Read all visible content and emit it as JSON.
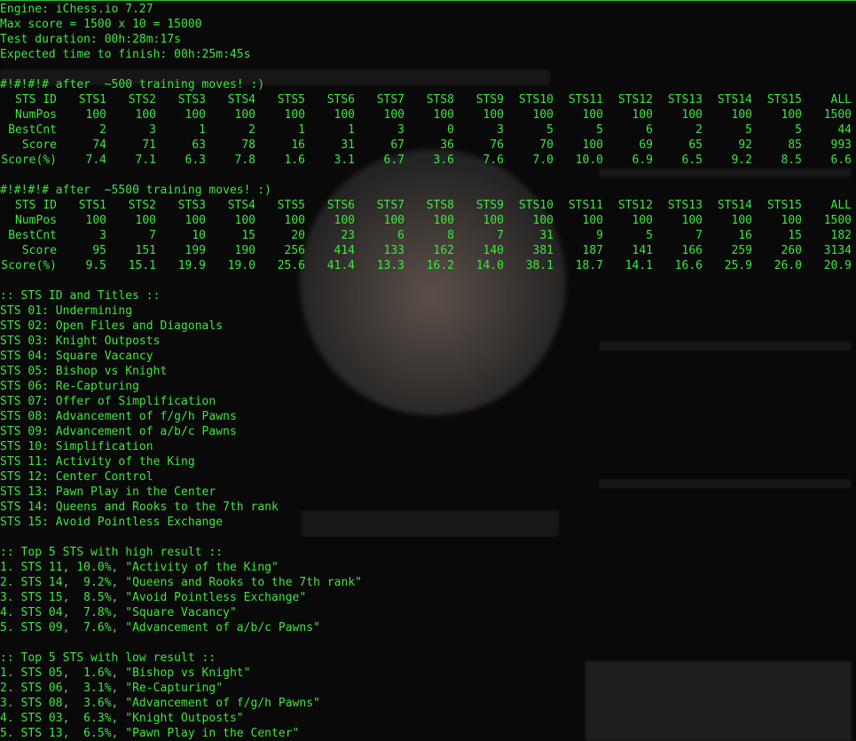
{
  "header": [
    "Engine: iChess.io 7.27",
    "Max score = 1500 x 10 = 15000",
    "Test duration: 00h:28m:17s",
    "Expected time to finish: 00h:25m:45s"
  ],
  "tables": [
    {
      "title": "#!#!#!# after  ~500 training moves! :)",
      "columns": [
        "STS ID",
        "STS1",
        "STS2",
        "STS3",
        "STS4",
        "STS5",
        "STS6",
        "STS7",
        "STS8",
        "STS9",
        "STS10",
        "STS11",
        "STS12",
        "STS13",
        "STS14",
        "STS15",
        "ALL"
      ],
      "rows": [
        [
          "NumPos",
          "100",
          "100",
          "100",
          "100",
          "100",
          "100",
          "100",
          "100",
          "100",
          "100",
          "100",
          "100",
          "100",
          "100",
          "100",
          "1500"
        ],
        [
          "BestCnt",
          "2",
          "3",
          "1",
          "2",
          "1",
          "1",
          "3",
          "0",
          "3",
          "5",
          "5",
          "6",
          "2",
          "5",
          "5",
          "44"
        ],
        [
          "Score",
          "74",
          "71",
          "63",
          "78",
          "16",
          "31",
          "67",
          "36",
          "76",
          "70",
          "100",
          "69",
          "65",
          "92",
          "85",
          "993"
        ],
        [
          "Score(%)",
          "7.4",
          "7.1",
          "6.3",
          "7.8",
          "1.6",
          "3.1",
          "6.7",
          "3.6",
          "7.6",
          "7.0",
          "10.0",
          "6.9",
          "6.5",
          "9.2",
          "8.5",
          "6.6"
        ]
      ]
    },
    {
      "title": "#!#!#!# after  ~5500 training moves! :)",
      "columns": [
        "STS ID",
        "STS1",
        "STS2",
        "STS3",
        "STS4",
        "STS5",
        "STS6",
        "STS7",
        "STS8",
        "STS9",
        "STS10",
        "STS11",
        "STS12",
        "STS13",
        "STS14",
        "STS15",
        "ALL"
      ],
      "rows": [
        [
          "NumPos",
          "100",
          "100",
          "100",
          "100",
          "100",
          "100",
          "100",
          "100",
          "100",
          "100",
          "100",
          "100",
          "100",
          "100",
          "100",
          "1500"
        ],
        [
          "BestCnt",
          "3",
          "7",
          "10",
          "15",
          "20",
          "23",
          "6",
          "8",
          "7",
          "31",
          "9",
          "5",
          "7",
          "16",
          "15",
          "182"
        ],
        [
          "Score",
          "95",
          "151",
          "199",
          "190",
          "256",
          "414",
          "133",
          "162",
          "140",
          "381",
          "187",
          "141",
          "166",
          "259",
          "260",
          "3134"
        ],
        [
          "Score(%)",
          "9.5",
          "15.1",
          "19.9",
          "19.0",
          "25.6",
          "41.4",
          "13.3",
          "16.2",
          "14.0",
          "38.1",
          "18.7",
          "14.1",
          "16.6",
          "25.9",
          "26.0",
          "20.9"
        ]
      ]
    }
  ],
  "titles_heading": ":: STS ID and Titles ::",
  "titles": [
    "STS 01: Undermining",
    "STS 02: Open Files and Diagonals",
    "STS 03: Knight Outposts",
    "STS 04: Square Vacancy",
    "STS 05: Bishop vs Knight",
    "STS 06: Re-Capturing",
    "STS 07: Offer of Simplification",
    "STS 08: Advancement of f/g/h Pawns",
    "STS 09: Advancement of a/b/c Pawns",
    "STS 10: Simplification",
    "STS 11: Activity of the King",
    "STS 12: Center Control",
    "STS 13: Pawn Play in the Center",
    "STS 14: Queens and Rooks to the 7th rank",
    "STS 15: Avoid Pointless Exchange"
  ],
  "top_high_heading": ":: Top 5 STS with high result ::",
  "top_high": [
    "1. STS 11, 10.0%, \"Activity of the King\"",
    "2. STS 14,  9.2%, \"Queens and Rooks to the 7th rank\"",
    "3. STS 15,  8.5%, \"Avoid Pointless Exchange\"",
    "4. STS 04,  7.8%, \"Square Vacancy\"",
    "5. STS 09,  7.6%, \"Advancement of a/b/c Pawns\""
  ],
  "top_low_heading": ":: Top 5 STS with low result ::",
  "top_low": [
    "1. STS 05,  1.6%, \"Bishop vs Knight\"",
    "2. STS 06,  3.1%, \"Re-Capturing\"",
    "3. STS 08,  3.6%, \"Advancement of f/g/h Pawns\"",
    "4. STS 03,  6.3%, \"Knight Outposts\"",
    "5. STS 13,  6.5%, \"Pawn Play in the Center\""
  ],
  "colors": {
    "text": "#3fe63f",
    "background": "#0b0c0b",
    "border": "#2cc32c"
  }
}
